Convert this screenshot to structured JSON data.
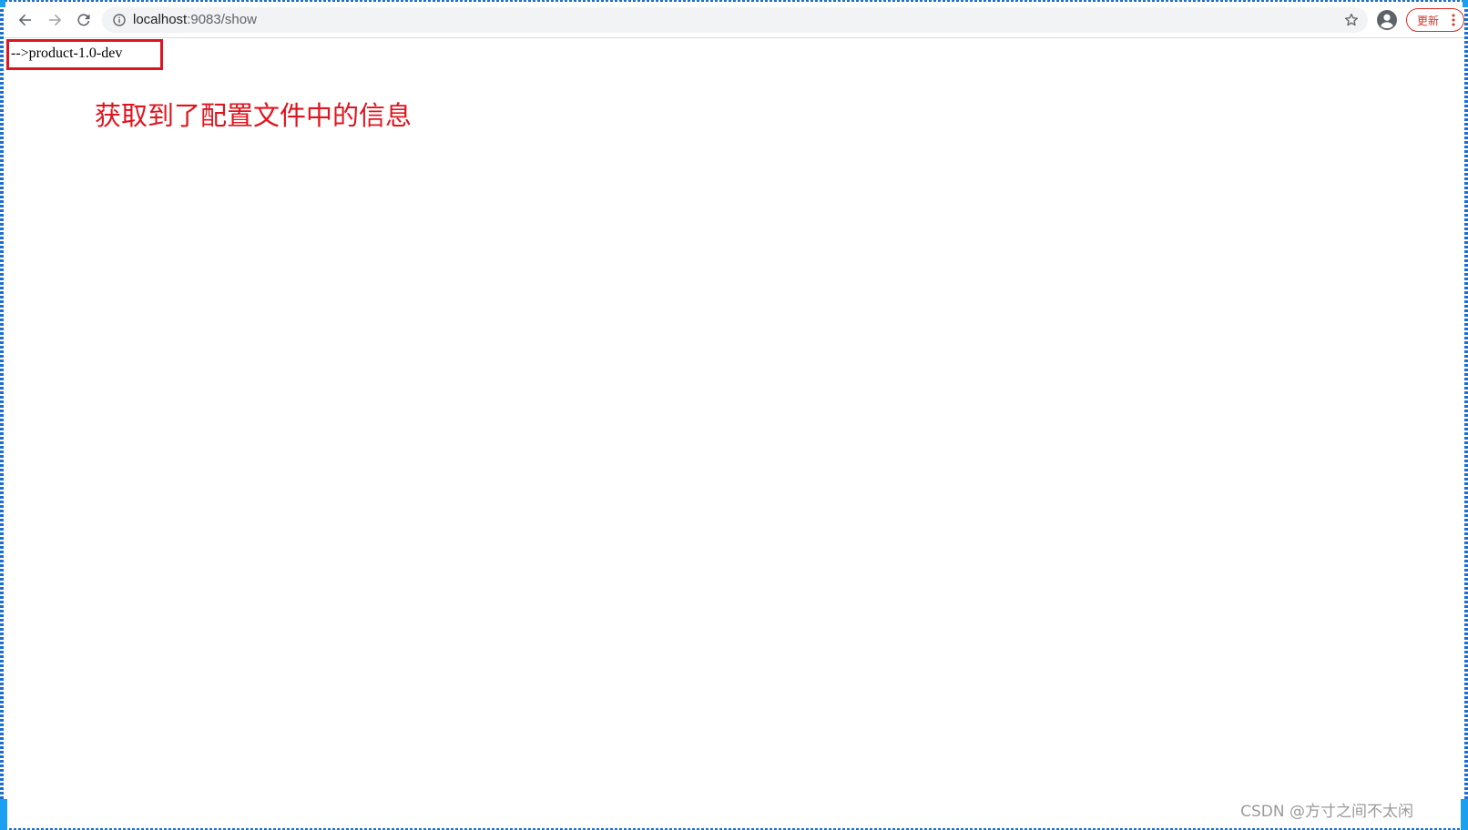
{
  "browser": {
    "url_host": "localhost",
    "url_rest": ":9083/show",
    "update_label": "更新"
  },
  "icons": {
    "back": "arrow-left-icon",
    "forward": "arrow-right-icon",
    "reload": "reload-icon",
    "site_info": "info-icon",
    "bookmark": "star-icon",
    "profile": "account-circle-icon",
    "menu": "more-vertical-icon"
  },
  "page": {
    "output_text": "-->product-1.0-dev"
  },
  "annotation": {
    "text": "获取到了配置文件中的信息",
    "color": "#e0141e"
  },
  "watermark": {
    "text": "CSDN @方寸之间不太闲"
  }
}
